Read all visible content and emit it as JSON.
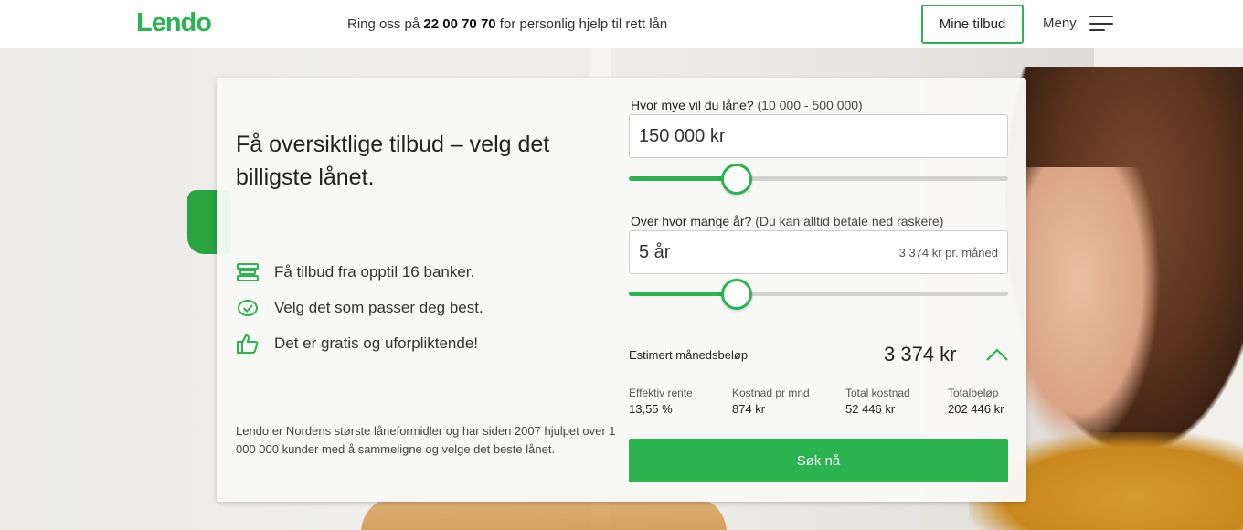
{
  "header": {
    "logo": "Lendo",
    "phone_prefix": "Ring oss på ",
    "phone_number": "22 00 70 70",
    "phone_suffix": " for personlig hjelp til rett lån",
    "my_offers_label": "Mine tilbud",
    "menu_label": "Meny"
  },
  "card": {
    "headline": "Få oversiktlige tilbud – velg det billigste lånet.",
    "features": [
      {
        "icon": "stack-icon",
        "label": "Få tilbud fra opptil 16 banker."
      },
      {
        "icon": "check-badge-icon",
        "label": "Velg det som passer deg best."
      },
      {
        "icon": "thumbs-up-icon",
        "label": "Det er gratis og uforpliktende!"
      }
    ],
    "footnote": "Lendo er Nordens største låneformidler og har siden 2007 hjulpet over 1 000 000 kunder med å sammeligne og velge det beste lånet."
  },
  "calculator": {
    "amount_label": "Hvor mye vil du låne?",
    "amount_hint": "(10 000 - 500 000)",
    "amount_value": "150 000 kr",
    "amount_slider_fraction": 0.285,
    "years_label": "Over hvor mange år?",
    "years_hint": "(Du kan alltid betale ned raskere)",
    "years_value": "5 år",
    "years_monthly": "3 374 kr pr. måned",
    "years_slider_fraction": 0.285,
    "estimate_label": "Estimert månedsbeløp",
    "estimate_value": "3 374 kr",
    "stats": [
      {
        "label": "Effektiv rente",
        "value": "13,55 %"
      },
      {
        "label": "Kostnad pr mnd",
        "value": "874 kr"
      },
      {
        "label": "Total kostnad",
        "value": "52 446 kr"
      },
      {
        "label": "Totalbeløp",
        "value": "202 446 kr"
      }
    ],
    "submit_label": "Søk nå"
  },
  "colors": {
    "brand_green": "#2bb34f",
    "track_gray": "#d2d2d2"
  }
}
